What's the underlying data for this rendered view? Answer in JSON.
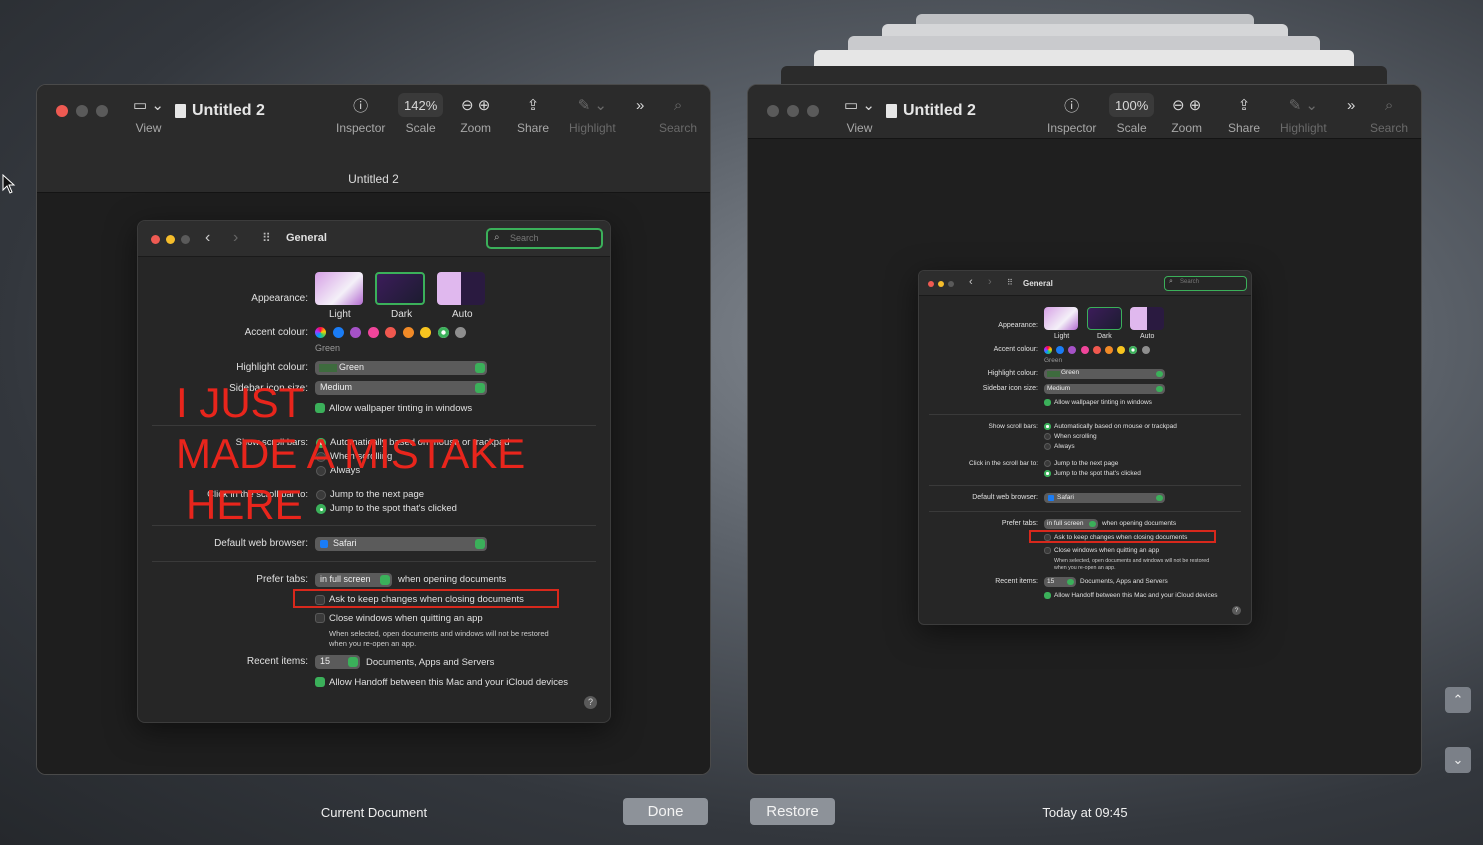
{
  "stack_windows": [
    {
      "color": "#bfc1c4"
    },
    {
      "color": "#d5d6d8"
    },
    {
      "color": "#c9cacd"
    },
    {
      "color": "#e6e6e6"
    }
  ],
  "left": {
    "title": "Untitled 2",
    "subtitle": "Untitled 2",
    "toolbar": {
      "view": "View",
      "inspector": "Inspector",
      "scale_value": "142%",
      "scale": "Scale",
      "zoom": "Zoom",
      "share": "Share",
      "highlight": "Highlight",
      "search": "Search"
    },
    "caption": "Current Document"
  },
  "right": {
    "title": "Untitled 2",
    "toolbar": {
      "view": "View",
      "inspector": "Inspector",
      "scale_value": "100%",
      "scale": "Scale",
      "zoom": "Zoom",
      "share": "Share",
      "highlight": "Highlight",
      "search": "Search"
    },
    "caption": "Today at 09:45"
  },
  "buttons": {
    "done": "Done",
    "restore": "Restore"
  },
  "prefs": {
    "title": "General",
    "search_placeholder": "Search",
    "appearance_label": "Appearance:",
    "appearance_options": [
      "Light",
      "Dark",
      "Auto"
    ],
    "accent_label": "Accent colour:",
    "accent_selected": "Green",
    "accent_colors": [
      "#a35bd6",
      "#1a7cf5",
      "#a552c7",
      "#f0459b",
      "#f0584f",
      "#f18a27",
      "#f7c41f",
      "#3bb05a",
      "#8e8e8e"
    ],
    "highlight_label": "Highlight colour:",
    "highlight_value": "Green",
    "sidebar_label": "Sidebar icon size:",
    "sidebar_value": "Medium",
    "wallpaper_tinting": "Allow wallpaper tinting in windows",
    "scroll_label": "Show scroll bars:",
    "scroll_options": [
      "Automatically based on mouse or trackpad",
      "When scrolling",
      "Always"
    ],
    "click_label": "Click in the scroll bar to:",
    "click_options": [
      "Jump to the next page",
      "Jump to the spot that's clicked"
    ],
    "browser_label": "Default web browser:",
    "browser_value": "Safari",
    "tabs_label": "Prefer tabs:",
    "tabs_value": "in full screen",
    "tabs_suffix": "when opening documents",
    "ask_keep": "Ask to keep changes when closing documents",
    "close_windows": "Close windows when quitting an app",
    "close_note_1": "When selected, open documents and windows will not be restored",
    "close_note_2": "when you re-open an app.",
    "recent_label": "Recent items:",
    "recent_value": "15",
    "recent_suffix": "Documents, Apps and Servers",
    "handoff": "Allow Handoff between this Mac and your iCloud devices",
    "help": "?"
  },
  "annotation": {
    "line1": "I JUST",
    "line2": "MADE  A MISTAKE",
    "line3": "HERE",
    "color": "#e8251c"
  }
}
